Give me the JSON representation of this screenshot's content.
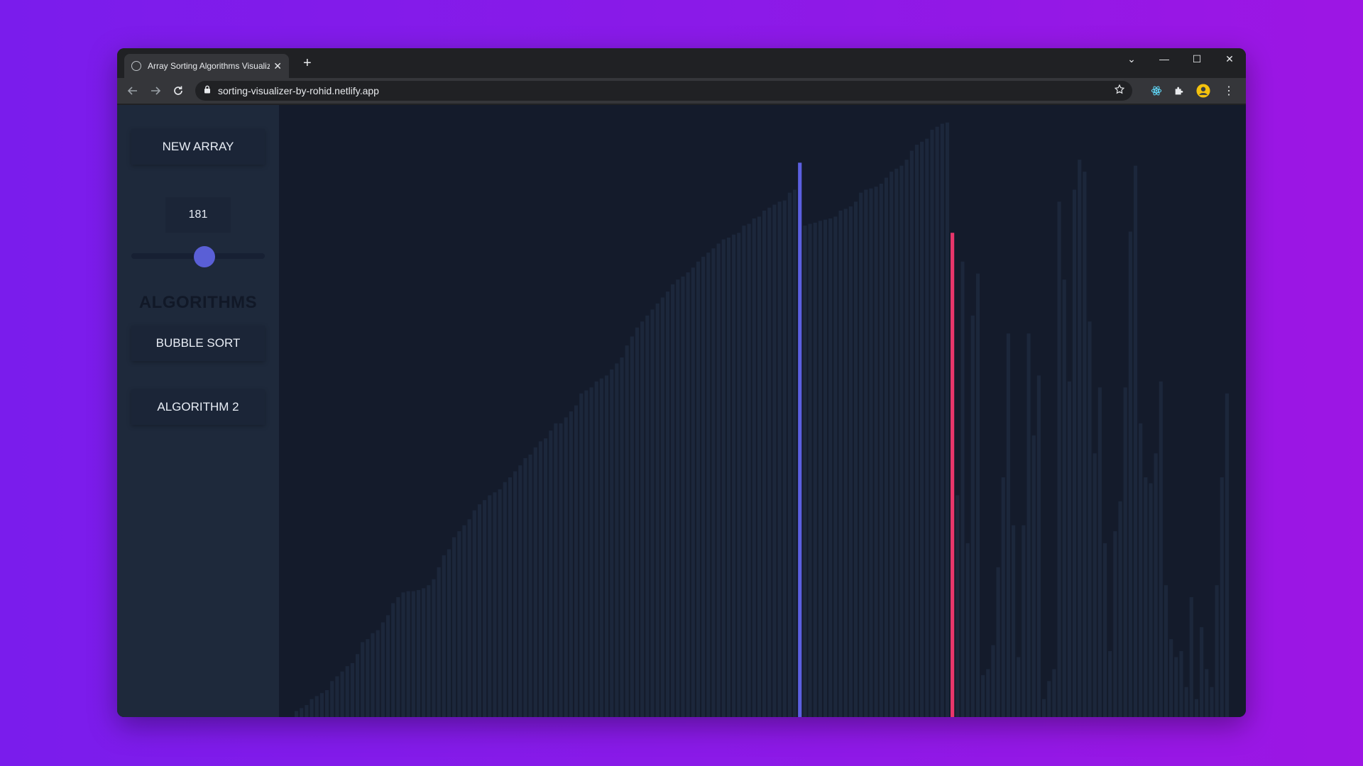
{
  "browser": {
    "tab_title": "Array Sorting Algorithms Visualiz",
    "new_tab": "+",
    "url": "sorting-visualizer-by-rohid.netlify.app"
  },
  "sidebar": {
    "new_array_label": "NEW ARRAY",
    "array_size": "181",
    "algorithms_heading": "ALGORITHMS",
    "algorithm_buttons": [
      "BUBBLE SORT",
      "ALGORITHM 2"
    ]
  },
  "colors": {
    "bar": "#1c273b",
    "compare_a": "#5b5fe0",
    "compare_b": "#e8366b"
  },
  "chart_data": {
    "type": "bar",
    "ylim": [
      0,
      1
    ],
    "highlight_indices": {
      "compare_a": 99,
      "compare_b": 129
    },
    "values": [
      0.01,
      0.015,
      0.02,
      0.03,
      0.035,
      0.04,
      0.045,
      0.06,
      0.068,
      0.076,
      0.085,
      0.09,
      0.105,
      0.125,
      0.13,
      0.14,
      0.145,
      0.158,
      0.17,
      0.19,
      0.2,
      0.208,
      0.21,
      0.21,
      0.212,
      0.215,
      0.22,
      0.23,
      0.25,
      0.27,
      0.28,
      0.3,
      0.31,
      0.32,
      0.33,
      0.345,
      0.355,
      0.362,
      0.37,
      0.375,
      0.38,
      0.392,
      0.4,
      0.41,
      0.42,
      0.432,
      0.438,
      0.45,
      0.46,
      0.465,
      0.478,
      0.49,
      0.49,
      0.5,
      0.51,
      0.52,
      0.54,
      0.545,
      0.55,
      0.56,
      0.565,
      0.57,
      0.58,
      0.59,
      0.6,
      0.62,
      0.635,
      0.65,
      0.66,
      0.67,
      0.68,
      0.69,
      0.7,
      0.71,
      0.722,
      0.73,
      0.735,
      0.742,
      0.75,
      0.76,
      0.768,
      0.775,
      0.782,
      0.79,
      0.797,
      0.8,
      0.805,
      0.808,
      0.82,
      0.823,
      0.832,
      0.835,
      0.845,
      0.85,
      0.855,
      0.86,
      0.862,
      0.875,
      0.88,
      0.925,
      0.82,
      0.823,
      0.825,
      0.828,
      0.83,
      0.832,
      0.835,
      0.845,
      0.848,
      0.852,
      0.86,
      0.875,
      0.88,
      0.882,
      0.885,
      0.89,
      0.9,
      0.91,
      0.915,
      0.92,
      0.93,
      0.945,
      0.955,
      0.96,
      0.965,
      0.98,
      0.985,
      0.99,
      0.992,
      0.808,
      0.37,
      0.76,
      0.29,
      0.67,
      0.74,
      0.07,
      0.08,
      0.12,
      0.25,
      0.4,
      0.64,
      0.32,
      0.1,
      0.32,
      0.64,
      0.47,
      0.57,
      0.03,
      0.06,
      0.08,
      0.86,
      0.73,
      0.56,
      0.88,
      0.93,
      0.91,
      0.66,
      0.44,
      0.55,
      0.29,
      0.11,
      0.31,
      0.36,
      0.55,
      0.81,
      0.92,
      0.49,
      0.4,
      0.39,
      0.44,
      0.56,
      0.22,
      0.13,
      0.1,
      0.11,
      0.05,
      0.2,
      0.03,
      0.15,
      0.08,
      0.05,
      0.22,
      0.4,
      0.54
    ]
  }
}
